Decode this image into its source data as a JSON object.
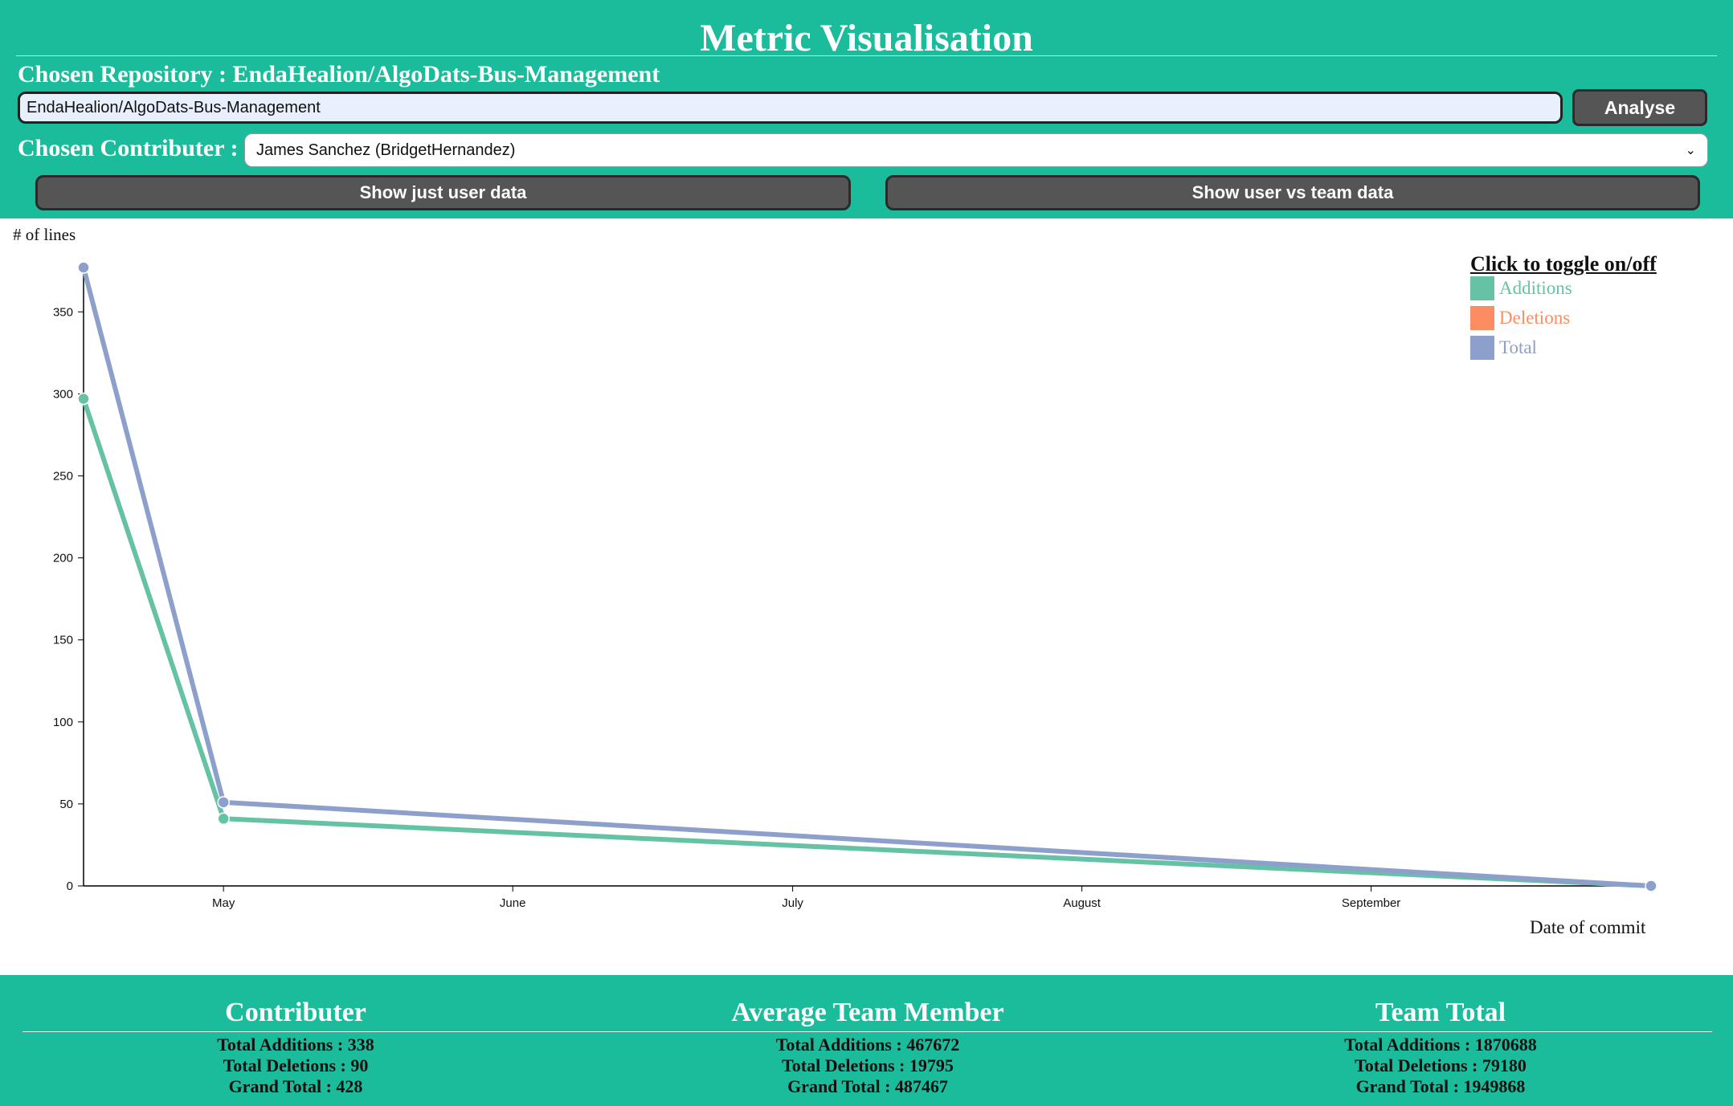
{
  "header": {
    "title": "Metric Visualisation",
    "repo_label": "Chosen Repository : EndaHealion/AlgoDats-Bus-Management",
    "repo_input_value": "EndaHealion/AlgoDats-Bus-Management",
    "analyse_label": "Analyse",
    "contributor_label": "Chosen Contributer :",
    "contributor_selected": "James Sanchez (BridgetHernandez)",
    "btn_user_label": "Show just user data",
    "btn_team_label": "Show user vs team data"
  },
  "legend": {
    "title": "Click to toggle on/off",
    "items": [
      {
        "label": "Additions",
        "color": "#66c2a5"
      },
      {
        "label": "Deletions",
        "color": "#fc8d62"
      },
      {
        "label": "Total",
        "color": "#8da0cb"
      }
    ]
  },
  "chart_data": {
    "type": "line",
    "ylabel": "# of lines",
    "xlabel": "Date of commit",
    "ylim": [
      0,
      380
    ],
    "yticks": [
      0,
      50,
      100,
      150,
      200,
      250,
      300,
      350
    ],
    "xticks": [
      "May",
      "June",
      "July",
      "August",
      "September"
    ],
    "x": [
      "2020-04-16",
      "2020-05-01",
      "2020-10-01"
    ],
    "series": [
      {
        "name": "Additions",
        "color": "#66c2a5",
        "values": [
          297,
          41,
          0
        ]
      },
      {
        "name": "Total",
        "color": "#8da0cb",
        "values": [
          377,
          51,
          0
        ]
      }
    ],
    "grid": false,
    "legend_position": "top-right"
  },
  "footer": {
    "contributor": {
      "title": "Contributer",
      "additions": "Total Additions : 338",
      "deletions": "Total Deletions : 90",
      "grand": "Grand Total : 428"
    },
    "average": {
      "title": "Average Team Member",
      "additions": "Total Additions : 467672",
      "deletions": "Total Deletions : 19795",
      "grand": "Grand Total : 487467"
    },
    "team": {
      "title": "Team Total",
      "additions": "Total Additions : 1870688",
      "deletions": "Total Deletions : 79180",
      "grand": "Grand Total : 1949868"
    }
  }
}
